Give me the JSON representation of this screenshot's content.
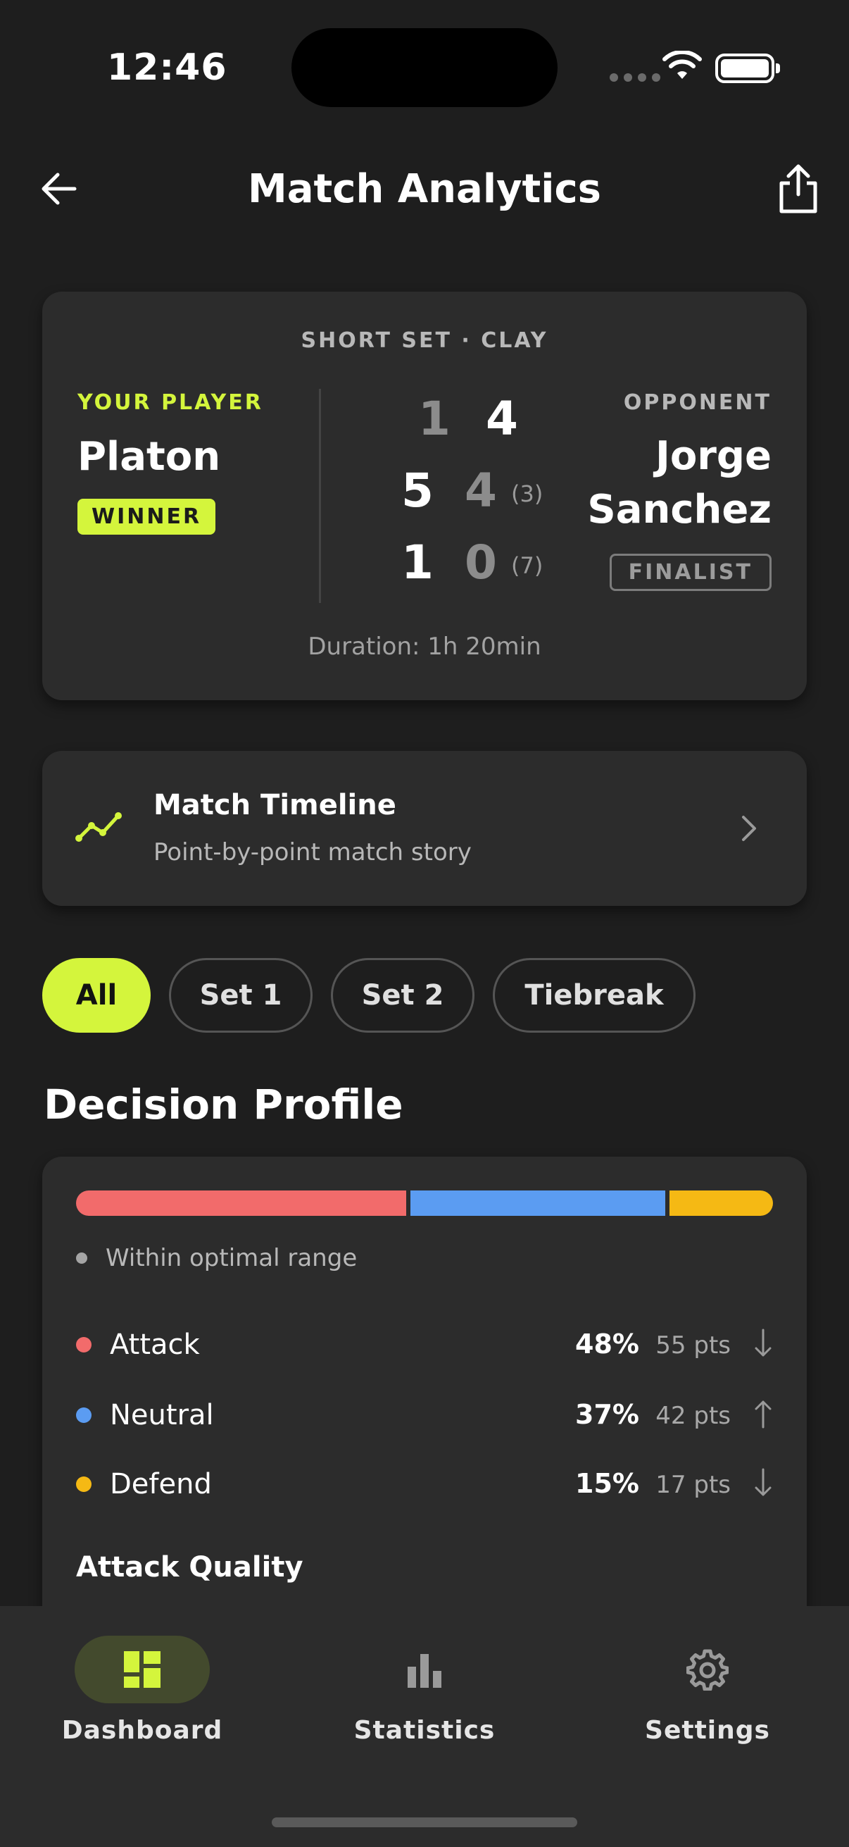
{
  "status_bar": {
    "time": "12:46"
  },
  "header": {
    "title": "Match Analytics"
  },
  "match": {
    "format": "SHORT SET · CLAY",
    "player": {
      "label": "YOUR PLAYER",
      "name": "Platon",
      "badge": "WINNER"
    },
    "opponent": {
      "label": "OPPONENT",
      "name_line1": "Jorge",
      "name_line2": "Sanchez",
      "badge": "FINALIST"
    },
    "sets": [
      {
        "player": "1",
        "opponent": "4",
        "tiebreak": ""
      },
      {
        "player": "5",
        "opponent": "4",
        "tiebreak": "(3)"
      },
      {
        "player": "1",
        "opponent": "0",
        "tiebreak": "(7)"
      }
    ],
    "duration": "Duration: 1h 20min"
  },
  "timeline": {
    "title": "Match Timeline",
    "subtitle": "Point-by-point match story"
  },
  "filters": [
    {
      "label": "All",
      "active": true
    },
    {
      "label": "Set 1",
      "active": false
    },
    {
      "label": "Set 2",
      "active": false
    },
    {
      "label": "Tiebreak",
      "active": false
    }
  ],
  "decision_profile": {
    "title": "Decision Profile",
    "range_note": "Within optimal range",
    "metrics": [
      {
        "name": "Attack",
        "percent": "48%",
        "points": "55 pts",
        "trend": "down",
        "color": "#f26b6b",
        "share": 0.48
      },
      {
        "name": "Neutral",
        "percent": "37%",
        "points": "42 pts",
        "trend": "up",
        "color": "#5b9cf2",
        "share": 0.37
      },
      {
        "name": "Defend",
        "percent": "15%",
        "points": "17 pts",
        "trend": "down",
        "color": "#f5b914",
        "share": 0.15
      }
    ],
    "attack_quality_title": "Attack Quality"
  },
  "tabs": [
    {
      "label": "Dashboard",
      "icon": "dashboard-icon",
      "active": true
    },
    {
      "label": "Statistics",
      "icon": "bar-chart-icon",
      "active": false
    },
    {
      "label": "Settings",
      "icon": "gear-icon",
      "active": false
    }
  ],
  "colors": {
    "accent": "#d4f53c",
    "background": "#1e1e1e",
    "card": "#2c2c2c"
  }
}
